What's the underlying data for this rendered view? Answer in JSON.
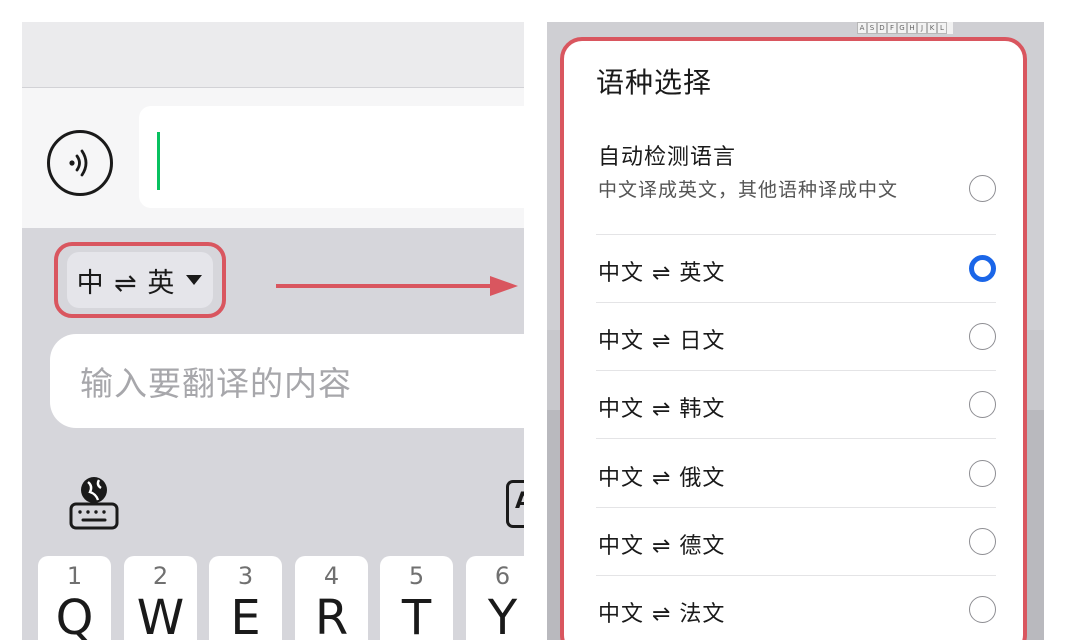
{
  "left": {
    "lang_pair": "中 ⇌ 英",
    "translate_placeholder": "输入要翻译的内容",
    "kb_side_letter": "A",
    "keys": [
      {
        "num": "1",
        "letter": "Q"
      },
      {
        "num": "2",
        "letter": "W"
      },
      {
        "num": "3",
        "letter": "E"
      },
      {
        "num": "4",
        "letter": "R"
      },
      {
        "num": "5",
        "letter": "T"
      },
      {
        "num": "6",
        "letter": "Y"
      }
    ]
  },
  "right": {
    "mini_keys": [
      "A",
      "S",
      "D",
      "F",
      "G",
      "H",
      "J",
      "K",
      "L"
    ],
    "sheet_title": "语种选择",
    "options": [
      {
        "label": "自动检测语言",
        "sublabel": "中文译成英文，其他语种译成中文",
        "selected": false
      },
      {
        "label": "中文 ⇌ 英文",
        "selected": true
      },
      {
        "label": "中文 ⇌ 日文",
        "selected": false
      },
      {
        "label": "中文 ⇌ 韩文",
        "selected": false
      },
      {
        "label": "中文 ⇌ 俄文",
        "selected": false
      },
      {
        "label": "中文 ⇌ 德文",
        "selected": false
      },
      {
        "label": "中文 ⇌ 法文",
        "selected": false
      }
    ]
  },
  "colors": {
    "highlight": "#d9565f",
    "radio_selected": "#1b66e8",
    "cursor": "#07c160"
  },
  "icons": {
    "voice": "voice-icon",
    "dropdown": "caret-down-icon",
    "keyboard_globe": "globe-keyboard-icon"
  }
}
